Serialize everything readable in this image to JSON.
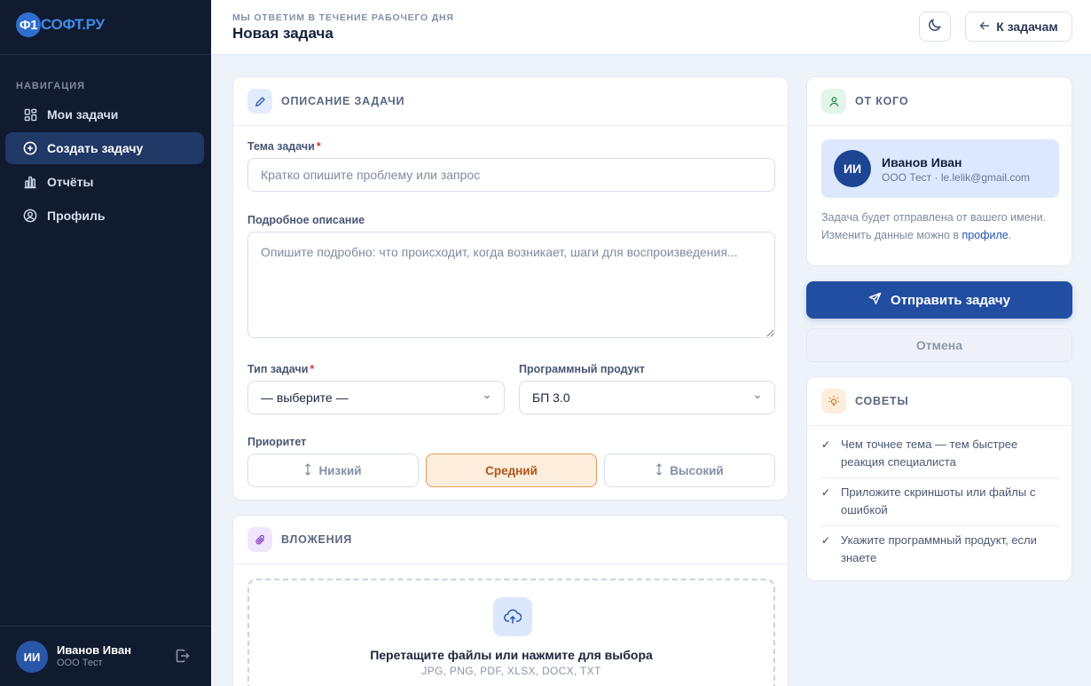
{
  "brand": {
    "badge": "Ф1",
    "name": "СОФТ.РУ"
  },
  "sidebar": {
    "nav_title": "НАВИГАЦИЯ",
    "items": [
      {
        "label": "Мои задачи",
        "icon": "grid-icon",
        "active": false
      },
      {
        "label": "Создать задачу",
        "icon": "plus-circle-icon",
        "active": true
      },
      {
        "label": "Отчёты",
        "icon": "bar-chart-icon",
        "active": false
      },
      {
        "label": "Профиль",
        "icon": "user-circle-icon",
        "active": false
      }
    ],
    "user": {
      "initials": "ИИ",
      "name": "Иванов Иван",
      "org": "ООО Тест"
    }
  },
  "header": {
    "eyebrow": "МЫ ОТВЕТИМ В ТЕЧЕНИЕ РАБОЧЕГО ДНЯ",
    "title": "Новая задача",
    "back_label": "К задачам"
  },
  "task_card": {
    "title": "ОПИСАНИЕ ЗАДАЧИ",
    "subject_label": "Тема задачи",
    "subject_placeholder": "Кратко опишите проблему или запрос",
    "description_label": "Подробное описание",
    "description_placeholder": "Опишите подробно: что происходит, когда возникает, шаги для воспроизведения...",
    "type_label": "Тип задачи",
    "type_value": "— выберите —",
    "product_label": "Программный продукт",
    "product_value": "БП 3.0",
    "priority_label": "Приоритет",
    "priorities": [
      {
        "label": "Низкий",
        "active": false
      },
      {
        "label": "Средний",
        "active": true
      },
      {
        "label": "Высокий",
        "active": false
      }
    ]
  },
  "attachments": {
    "title": "ВЛОЖЕНИЯ",
    "drop_title": "Перетащите файлы или нажмите для выбора",
    "types": "JPG, PNG, PDF, XLSX, DOCX, TXT"
  },
  "from_card": {
    "title": "ОТ КОГО",
    "initials": "ИИ",
    "name": "Иванов Иван",
    "meta": "ООО Тест · le.lelik@gmail.com",
    "note_text": "Задача будет отправлена от вашего имени. Изменить данные можно в ",
    "note_link": "профиле",
    "note_end": "."
  },
  "actions": {
    "submit": "Отправить задачу",
    "cancel": "Отмена"
  },
  "tips_card": {
    "title": "СОВЕТЫ",
    "items": [
      "Чем точнее тема — тем быстрее реакция специалиста",
      "Приложите скриншоты или файлы с ошибкой",
      "Укажите программный продукт, если знаете"
    ]
  },
  "colors": {
    "sidebar_bg": "#111b30",
    "primary": "#224ea1",
    "priority_active_bg": "#fdeddc",
    "priority_active_text": "#b1531a",
    "required": "#d23b3b"
  }
}
